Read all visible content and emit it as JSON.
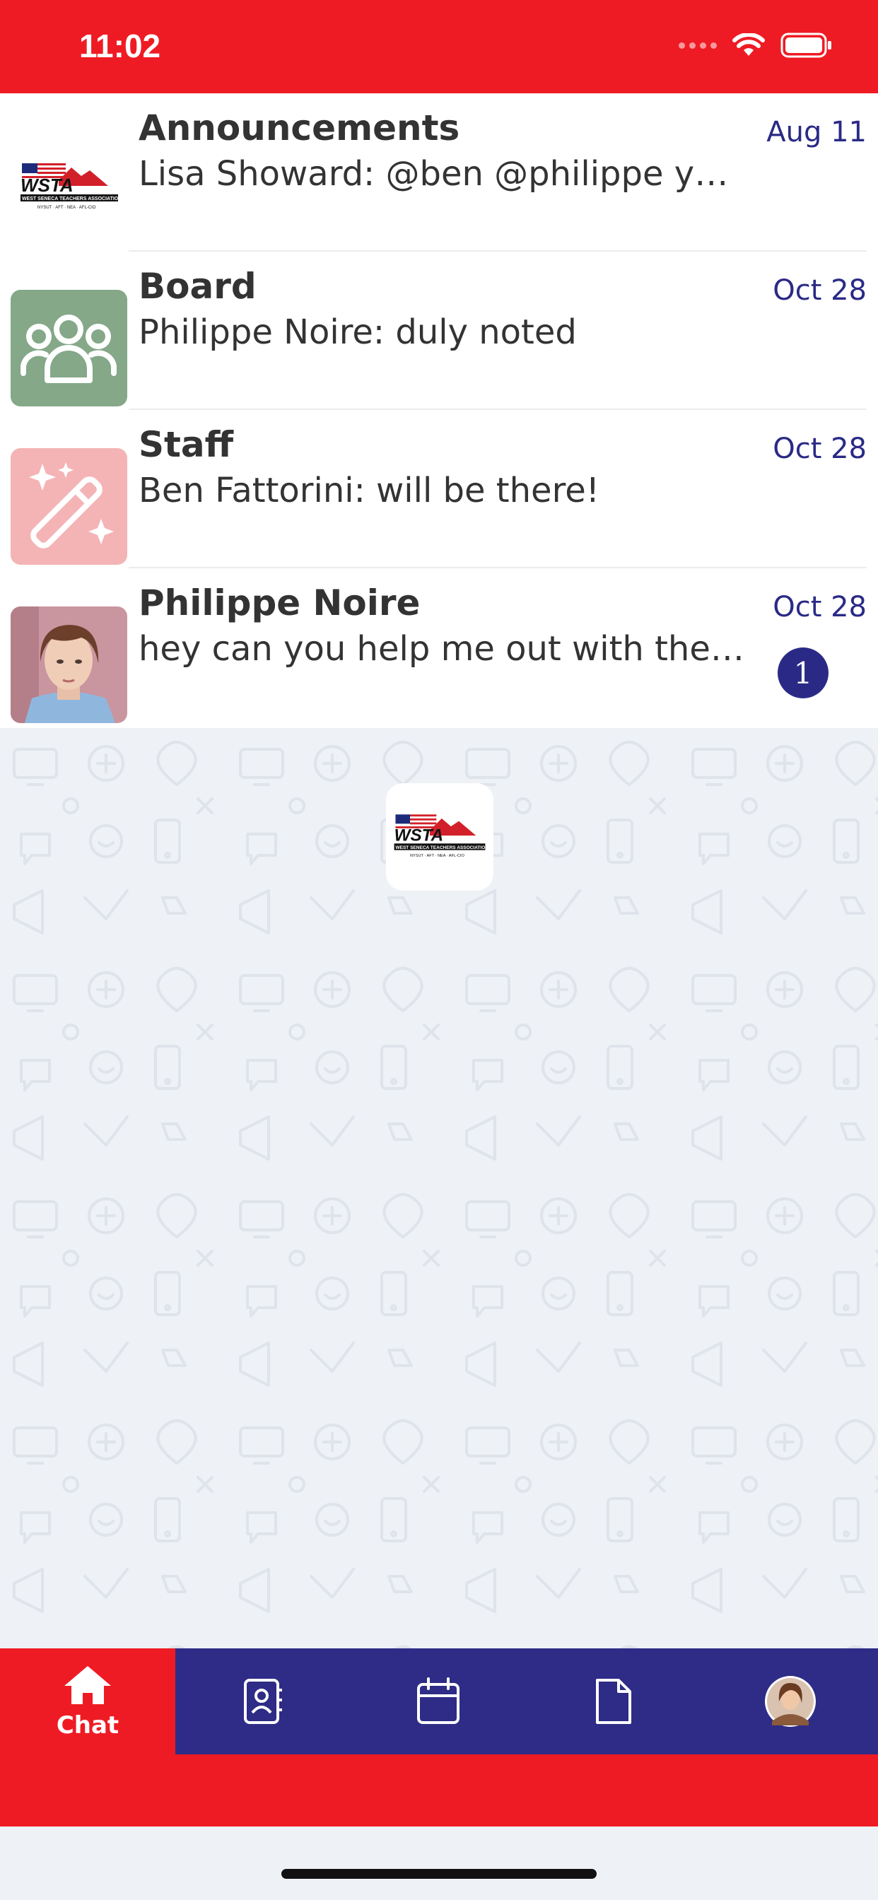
{
  "status_bar": {
    "time": "11:02"
  },
  "chats": [
    {
      "name": "Announcements",
      "preview": "Lisa Showard: @ben @philippe you ...",
      "date": "Aug 11",
      "avatar": "wsta-logo",
      "unread": null
    },
    {
      "name": "Board",
      "preview": "Philippe Noire: duly noted",
      "date": "Oct 28",
      "avatar": "group-icon",
      "avatar_color": "#84a888",
      "unread": null
    },
    {
      "name": "Staff",
      "preview": "Ben Fattorini: will be there!",
      "date": "Oct 28",
      "avatar": "magic-wand-icon",
      "avatar_color": "#f4b4b6",
      "unread": null
    },
    {
      "name": "Philippe Noire",
      "preview": "hey can you help me out with the r...",
      "date": "Oct 28",
      "avatar": "user-photo",
      "unread": "1"
    }
  ],
  "logo": {
    "wordmark": "WSTA",
    "subtitle": "WEST SENECA TEACHERS ASSOCIATION",
    "affiliations": "NYSUT · AFT · NEA · AFL-CIO"
  },
  "tab_bar": {
    "tabs": [
      {
        "icon": "home-icon",
        "label": "Chat",
        "active": true
      },
      {
        "icon": "contacts-icon",
        "label": ""
      },
      {
        "icon": "calendar-icon",
        "label": ""
      },
      {
        "icon": "document-icon",
        "label": ""
      },
      {
        "icon": "profile-avatar",
        "label": ""
      }
    ]
  },
  "colors": {
    "primary_red": "#ef1b24",
    "navy": "#2e2c86",
    "date_blue": "#2a2a86"
  }
}
